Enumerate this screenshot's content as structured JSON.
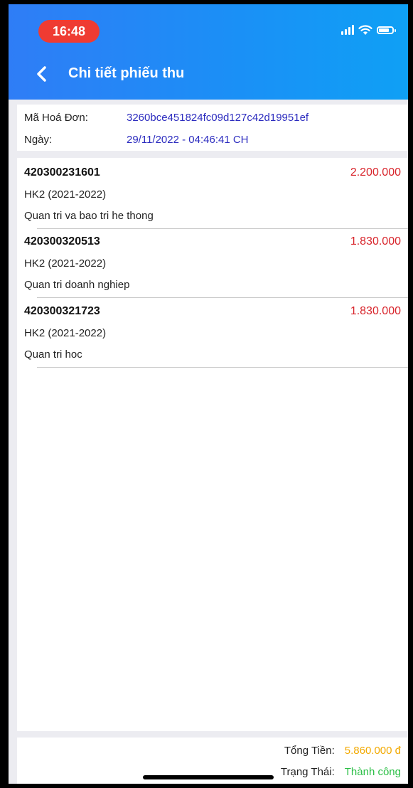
{
  "status_bar": {
    "time": "16:48"
  },
  "header": {
    "title": "Chi tiết phiếu thu"
  },
  "invoice": {
    "id_label": "Mã Hoá Đơn:",
    "id_value": "3260bce451824fc09d127c42d19951ef",
    "date_label": "Ngày:",
    "date_value": "29/11/2022 - 04:46:41 CH"
  },
  "items": [
    {
      "code": "420300231601",
      "amount": "2.200.000",
      "term": "HK2 (2021-2022)",
      "course": "Quan tri va bao tri he thong"
    },
    {
      "code": "420300320513",
      "amount": "1.830.000",
      "term": "HK2 (2021-2022)",
      "course": "Quan tri doanh nghiep"
    },
    {
      "code": "420300321723",
      "amount": "1.830.000",
      "term": "HK2 (2021-2022)",
      "course": "Quan tri hoc"
    }
  ],
  "footer": {
    "total_label": "Tổng Tiền:",
    "total_value": "5.860.000 đ",
    "status_label": "Trạng Thái:",
    "status_value": "Thành công"
  },
  "colors": {
    "header_start": "#2f7df6",
    "header_end": "#0fa0f5",
    "amount": "#d8232a",
    "invoice_value": "#2c2cbf",
    "total": "#f2a900",
    "status": "#2bbf46"
  }
}
